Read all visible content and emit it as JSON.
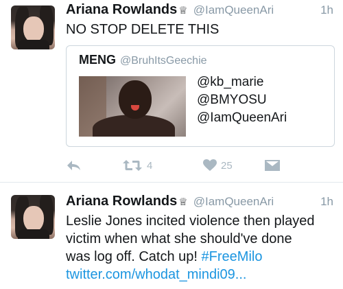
{
  "tweets": [
    {
      "author_name": "Ariana Rowlands",
      "verified_glyph": "♕",
      "handle": "@IamQueenAri",
      "time": "1h",
      "text": "NO STOP DELETE THIS",
      "quoted": {
        "name": "MENG",
        "handle": "@BruhItsGeechie",
        "lines": [
          "@kb_marie",
          "@BMYOSU",
          "@IamQueenAri"
        ]
      },
      "actions": {
        "retweets": "4",
        "likes": "25"
      }
    },
    {
      "author_name": "Ariana Rowlands",
      "verified_glyph": "♕",
      "handle": "@IamQueenAri",
      "time": "1h",
      "text_lines": [
        "Leslie Jones incited violence then played",
        "victim when what she should've done",
        "was log off. Catch up! "
      ],
      "hashtag": "#FreeMilo",
      "link": "twitter.com/whodat_mindi09..."
    }
  ],
  "colors": {
    "link": "#1b95e0",
    "meta_gray": "#8899a6",
    "icon_gray": "#aab8c2",
    "divider": "#e1e8ed"
  }
}
